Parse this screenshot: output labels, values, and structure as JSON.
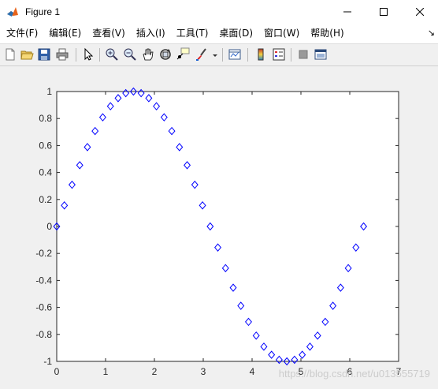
{
  "window": {
    "title": "Figure 1",
    "controls": [
      "minimize",
      "maximize",
      "close"
    ]
  },
  "menu": {
    "items": [
      "文件(F)",
      "编辑(E)",
      "查看(V)",
      "插入(I)",
      "工具(T)",
      "桌面(D)",
      "窗口(W)",
      "帮助(H)"
    ],
    "overflow": "↘"
  },
  "toolbar": {
    "icons": [
      "new-figure-icon",
      "open-file-icon",
      "save-icon",
      "print-icon",
      "edit-plot-arrow-icon",
      "zoom-in-icon",
      "zoom-out-icon",
      "pan-icon",
      "rotate-3d-icon",
      "data-cursor-icon",
      "brush-icon",
      "link-plot-icon",
      "colorbar-icon",
      "legend-icon",
      "hide-plot-tools-icon",
      "show-plot-tools-icon"
    ]
  },
  "watermark": "https://blog.csdn.net/u013555719",
  "chart_data": {
    "type": "scatter",
    "marker": "diamond",
    "marker_color": "#0000ff",
    "title": "",
    "xlabel": "",
    "ylabel": "",
    "xlim": [
      0,
      7
    ],
    "ylim": [
      -1,
      1
    ],
    "xticks": [
      "0",
      "1",
      "2",
      "3",
      "4",
      "5",
      "6",
      "7"
    ],
    "yticks": [
      "-1",
      "-0.8",
      "-0.6",
      "-0.4",
      "-0.2",
      "0",
      "0.2",
      "0.4",
      "0.6",
      "0.8",
      "1"
    ],
    "grid": false,
    "x": [
      0,
      0.157,
      0.314,
      0.471,
      0.628,
      0.785,
      0.942,
      1.1,
      1.257,
      1.414,
      1.571,
      1.728,
      1.885,
      2.042,
      2.199,
      2.356,
      2.513,
      2.67,
      2.827,
      2.985,
      3.142,
      3.299,
      3.456,
      3.613,
      3.77,
      3.927,
      4.084,
      4.241,
      4.398,
      4.555,
      4.712,
      4.869,
      5.027,
      5.184,
      5.341,
      5.498,
      5.655,
      5.812,
      5.969,
      6.126,
      6.283
    ],
    "y": [
      0,
      0.156,
      0.309,
      0.454,
      0.588,
      0.707,
      0.809,
      0.891,
      0.951,
      0.988,
      1,
      0.988,
      0.951,
      0.891,
      0.809,
      0.707,
      0.588,
      0.454,
      0.309,
      0.156,
      0,
      -0.156,
      -0.309,
      -0.454,
      -0.588,
      -0.707,
      -0.809,
      -0.891,
      -0.951,
      -0.988,
      -1,
      -0.988,
      -0.951,
      -0.891,
      -0.809,
      -0.707,
      -0.588,
      -0.454,
      -0.309,
      -0.156,
      0
    ]
  }
}
